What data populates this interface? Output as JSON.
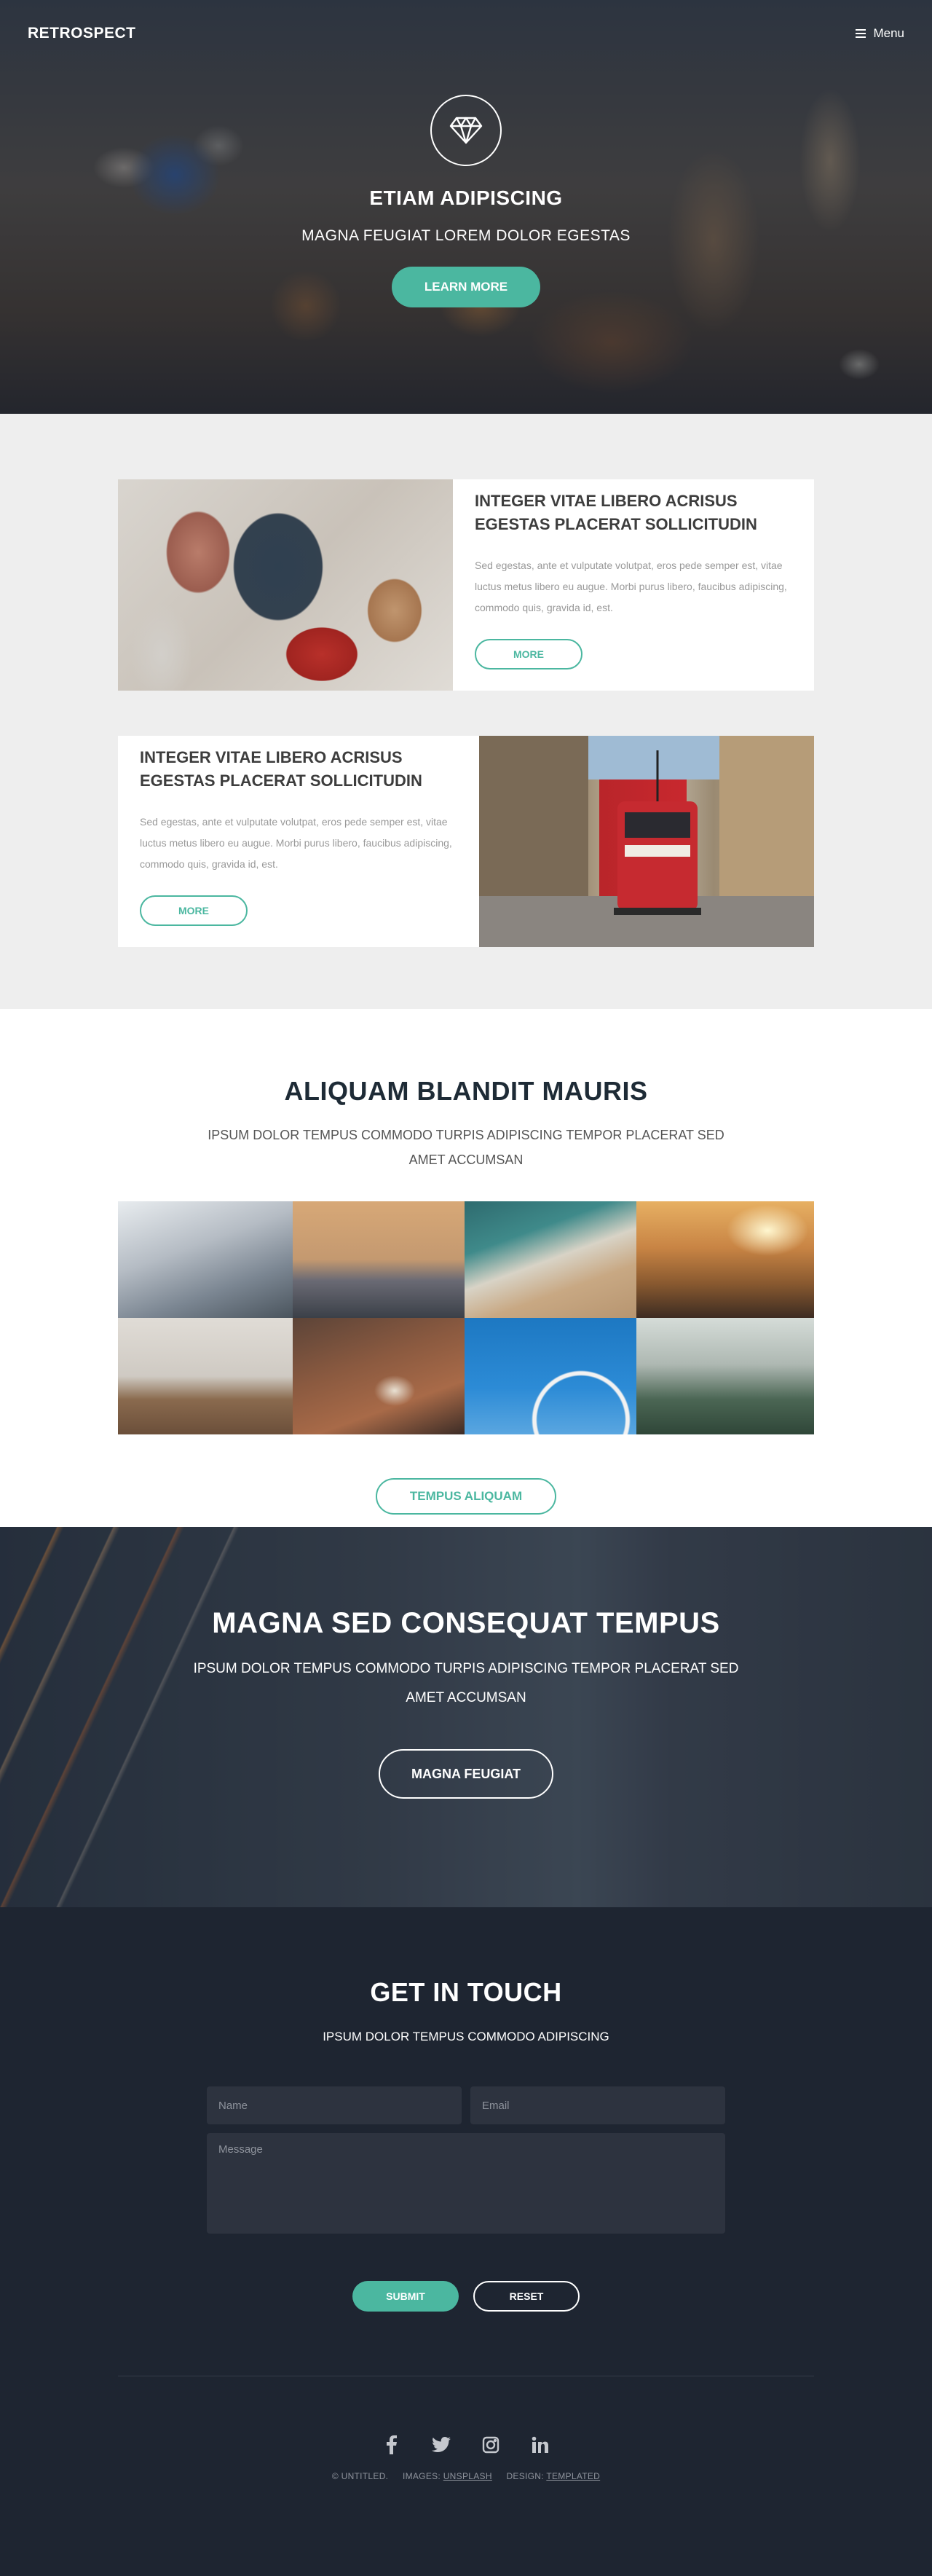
{
  "header": {
    "logo": "RETROSPECT",
    "menu_label": "Menu"
  },
  "banner": {
    "icon": "diamond-icon",
    "title": "ETIAM ADIPISCING",
    "subtitle": "MAGNA FEUGIAT LOREM DOLOR EGESTAS",
    "button": "LEARN MORE"
  },
  "spotlights": [
    {
      "title": "INTEGER VITAE LIBERO ACRISUS EGESTAS PLACERAT SOLLICITUDIN",
      "text": "Sed egestas, ante et vulputate volutpat, eros pede semper est, vitae luctus metus libero eu augue. Morbi purus libero, faucibus adipiscing, commodo quis, gravida id, est.",
      "button": "MORE",
      "image": "padlocks-photo"
    },
    {
      "title": "INTEGER VITAE LIBERO ACRISUS EGESTAS PLACERAT SOLLICITUDIN",
      "text": "Sed egestas, ante et vulputate volutpat, eros pede semper est, vitae luctus metus libero eu augue. Morbi purus libero, faucibus adipiscing, commodo quis, gravida id, est.",
      "button": "MORE",
      "image": "red-tram-photo"
    }
  ],
  "gallery": {
    "title": "ALIQUAM BLANDIT MAURIS",
    "subtitle_line1": "IPSUM DOLOR TEMPUS COMMODO TURPIS ADIPISCING TEMPOR PLACERAT SED",
    "subtitle_line2": "AMET ACCUMSAN",
    "button": "TEMPUS ALIQUAM",
    "images": [
      "sail-photo",
      "lifeguard-tower-photo",
      "beach-waves-photo",
      "surfboard-sunset-photo",
      "dining-chairs-photo",
      "coffee-table-photo",
      "ferris-wheel-photo",
      "misty-forest-photo"
    ]
  },
  "cta": {
    "title": "MAGNA SED CONSEQUAT TEMPUS",
    "text_line1": "IPSUM DOLOR TEMPUS COMMODO TURPIS ADIPISCING TEMPOR PLACERAT SED",
    "text_line2": "AMET ACCUMSAN",
    "button": "MAGNA FEUGIAT"
  },
  "contact": {
    "title": "GET IN TOUCH",
    "subtitle": "IPSUM DOLOR TEMPUS COMMODO ADIPISCING",
    "name_placeholder": "Name",
    "email_placeholder": "Email",
    "message_placeholder": "Message",
    "submit": "SUBMIT",
    "reset": "RESET"
  },
  "footer": {
    "social": [
      "facebook-icon",
      "twitter-icon",
      "instagram-icon",
      "linkedin-icon"
    ],
    "copyright": "© UNTITLED.",
    "images_label": "IMAGES:",
    "images_link": "UNSPLASH",
    "design_label": "DESIGN:",
    "design_link": "TEMPLATED"
  },
  "colors": {
    "accent": "#4bb7a0",
    "dark": "#1e2531",
    "light_bg": "#eeeeee"
  }
}
